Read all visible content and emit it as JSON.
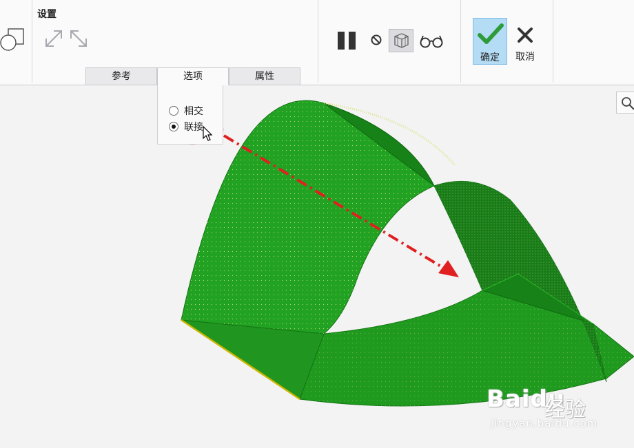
{
  "settings": {
    "title": "设置"
  },
  "tabs": [
    {
      "label": "参考",
      "active": false
    },
    {
      "label": "选项",
      "active": true
    },
    {
      "label": "属性",
      "active": false
    }
  ],
  "actions": {
    "ok_label": "确定",
    "cancel_label": "取消"
  },
  "options": {
    "radio_intersect": {
      "label": "相交",
      "checked": false
    },
    "radio_join": {
      "label": "联接",
      "checked": true
    }
  },
  "icons": {
    "pause": "pause-icon",
    "stop": "no-entry-icon",
    "preview": "wireframe-preview-icon",
    "glasses": "glasses-icon",
    "ok": "checkmark-icon",
    "cancel": "x-icon",
    "search": "zoom-icon"
  },
  "colors": {
    "surface": "#1f9a1f",
    "surface_dark": "#157515",
    "annotation": "#e02020",
    "ok_bg": "#b5dcf5"
  },
  "watermark": {
    "logo": "Baidu",
    "text": "经验",
    "url": "jingyan.baidu.com"
  }
}
